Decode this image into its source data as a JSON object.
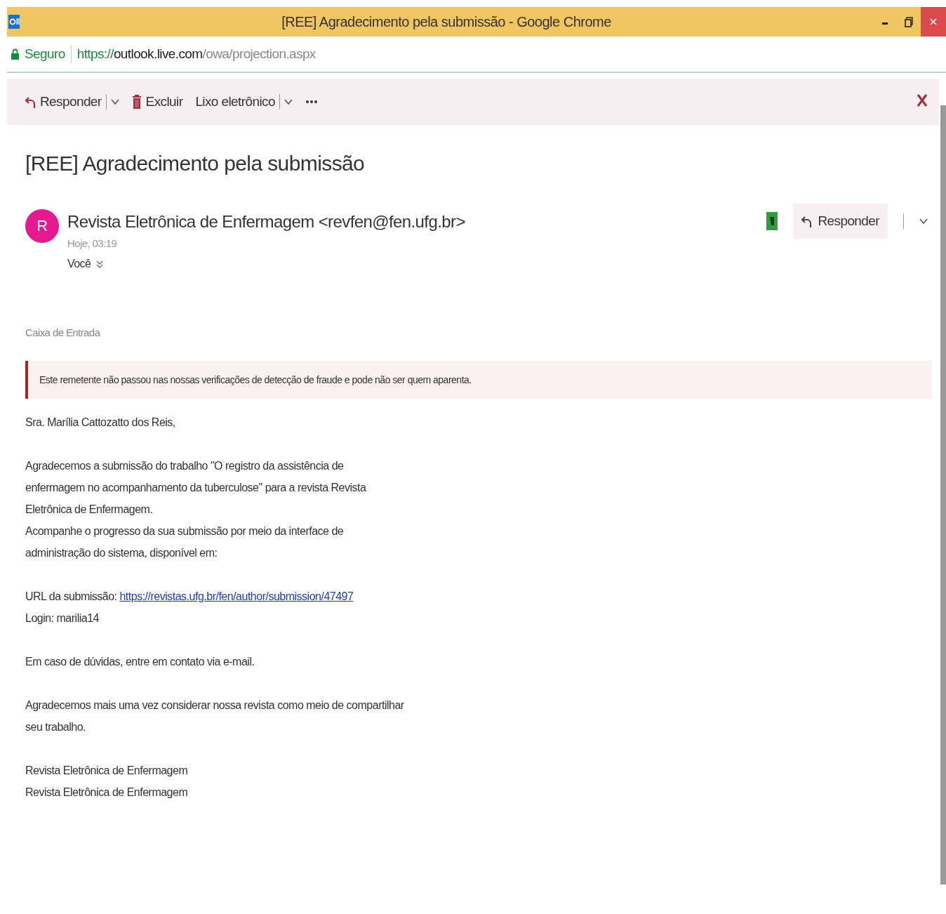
{
  "window": {
    "title": "[REE] Agradecimento pela submissão - Google Chrome",
    "controls": [
      {
        "kind": "minimize"
      },
      {
        "kind": "restore"
      },
      {
        "kind": "close"
      }
    ]
  },
  "address_bar": {
    "security_label": "Seguro",
    "url": {
      "scheme": "https://",
      "host": "outlook.live.com",
      "path": "/owa/projection.aspx"
    }
  },
  "toolbar": {
    "items": [
      {
        "kind": "reply",
        "label": "Responder",
        "dropdown": true
      },
      {
        "kind": "delete",
        "label": "Excluir",
        "dropdown": false
      },
      {
        "kind": "junk",
        "label": "Lixo eletrônico",
        "dropdown": true
      },
      {
        "kind": "more",
        "dropdown": false
      }
    ]
  },
  "message": {
    "subject": "[REE] Agradecimento pela submissão",
    "sender": {
      "initial": "R",
      "name": "Revista Eletrônica de Enfermagem <revfen@fen.ufg.br>",
      "time": "Hoje, 03:19",
      "recipient": "Você"
    },
    "reply_button": {
      "label": "Responder"
    },
    "folder": "Caixa de Entrada",
    "warning": "Este remetente não passou nas nossas verificações de detecção de fraude e pode não ser quem aparenta.",
    "body": [
      {
        "kind": "text",
        "lines": [
          "Sra. Marília Cattozatto dos Reis,"
        ]
      },
      {
        "kind": "text",
        "lines": [
          "Agradecemos a submissão do trabalho \"O registro da assistência de",
          "enfermagem no acompanhamento da tuberculose\" para a revista Revista",
          "Eletrônica de Enfermagem.",
          "Acompanhe o progresso da sua submissão por meio da interface de",
          "administração do sistema, disponível em:"
        ]
      },
      {
        "kind": "link",
        "label": "URL da submissão:",
        "link": "https://revistas.ufg.br/fen/author/submission/47497",
        "after": "Login: marilia14"
      },
      {
        "kind": "text",
        "lines": [
          "Em caso de dúvidas,  entre em contato via e-mail."
        ]
      },
      {
        "kind": "text",
        "lines": [
          "Agradecemos mais uma vez considerar nossa revista como meio de compartilhar",
          "seu trabalho."
        ]
      },
      {
        "kind": "text",
        "lines": [
          "Revista Eletrônica de Enfermagem",
          "Revista Eletrônica de Enfermagem"
        ]
      }
    ]
  }
}
